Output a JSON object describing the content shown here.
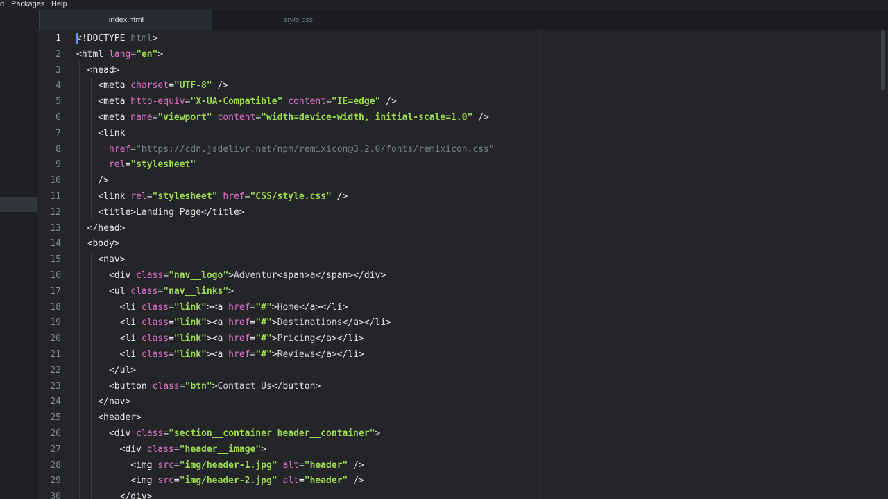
{
  "menu": {
    "items": [
      "d",
      "Packages",
      "Help"
    ]
  },
  "tabs": [
    {
      "label": "index.html",
      "active": true
    },
    {
      "label": "style.css",
      "active": false
    }
  ],
  "editor": {
    "active_line": 1,
    "lines": [
      [
        [
          "t",
          "<!DOCTYPE "
        ],
        [
          "u",
          "html"
        ],
        [
          "t",
          ">"
        ]
      ],
      [
        [
          "t",
          "<html "
        ],
        [
          "a",
          "lang"
        ],
        [
          "t",
          "="
        ],
        [
          "s",
          "\"en\""
        ],
        [
          "t",
          ">"
        ]
      ],
      [
        [
          "t",
          "  <head>"
        ]
      ],
      [
        [
          "t",
          "    <meta "
        ],
        [
          "a",
          "charset"
        ],
        [
          "t",
          "="
        ],
        [
          "s",
          "\"UTF-8\""
        ],
        [
          "t",
          " />"
        ]
      ],
      [
        [
          "t",
          "    <meta "
        ],
        [
          "a",
          "http-equiv"
        ],
        [
          "t",
          "="
        ],
        [
          "s",
          "\"X-UA-Compatible\""
        ],
        [
          "t",
          " "
        ],
        [
          "a",
          "content"
        ],
        [
          "t",
          "="
        ],
        [
          "s",
          "\"IE=edge\""
        ],
        [
          "t",
          " />"
        ]
      ],
      [
        [
          "t",
          "    <meta "
        ],
        [
          "a",
          "name"
        ],
        [
          "t",
          "="
        ],
        [
          "s",
          "\"viewport\""
        ],
        [
          "t",
          " "
        ],
        [
          "a",
          "content"
        ],
        [
          "t",
          "="
        ],
        [
          "s",
          "\"width=device-width, initial-scale=1.0\""
        ],
        [
          "t",
          " />"
        ]
      ],
      [
        [
          "t",
          "    <link"
        ]
      ],
      [
        [
          "t",
          "      "
        ],
        [
          "a",
          "href"
        ],
        [
          "t",
          "="
        ],
        [
          "u",
          "\"https://cdn.jsdelivr.net/npm/remixicon@3.2.0/fonts/remixicon.css\""
        ]
      ],
      [
        [
          "t",
          "      "
        ],
        [
          "a",
          "rel"
        ],
        [
          "t",
          "="
        ],
        [
          "s",
          "\"stylesheet\""
        ]
      ],
      [
        [
          "t",
          "    />"
        ]
      ],
      [
        [
          "t",
          "    <link "
        ],
        [
          "a",
          "rel"
        ],
        [
          "t",
          "="
        ],
        [
          "s",
          "\"stylesheet\""
        ],
        [
          "t",
          " "
        ],
        [
          "a",
          "href"
        ],
        [
          "t",
          "="
        ],
        [
          "s",
          "\"CSS/style.css\""
        ],
        [
          "t",
          " />"
        ]
      ],
      [
        [
          "t",
          "    <title>"
        ],
        [
          "txt",
          "Landing Page"
        ],
        [
          "t",
          "</title>"
        ]
      ],
      [
        [
          "t",
          "  </head>"
        ]
      ],
      [
        [
          "t",
          "  <body>"
        ]
      ],
      [
        [
          "t",
          "    <nav>"
        ]
      ],
      [
        [
          "t",
          "      <div "
        ],
        [
          "a",
          "class"
        ],
        [
          "t",
          "="
        ],
        [
          "s",
          "\"nav__logo\""
        ],
        [
          "t",
          ">"
        ],
        [
          "txt",
          "Adventur"
        ],
        [
          "t",
          "<span>"
        ],
        [
          "txt",
          "a"
        ],
        [
          "t",
          "</span></div>"
        ]
      ],
      [
        [
          "t",
          "      <ul "
        ],
        [
          "a",
          "class"
        ],
        [
          "t",
          "="
        ],
        [
          "s",
          "\"nav__links\""
        ],
        [
          "t",
          ">"
        ]
      ],
      [
        [
          "t",
          "        <li "
        ],
        [
          "a",
          "class"
        ],
        [
          "t",
          "="
        ],
        [
          "s",
          "\"link\""
        ],
        [
          "t",
          "><a "
        ],
        [
          "a",
          "href"
        ],
        [
          "t",
          "="
        ],
        [
          "s",
          "\"#\""
        ],
        [
          "t",
          ">"
        ],
        [
          "txt",
          "Home"
        ],
        [
          "t",
          "</a></li>"
        ]
      ],
      [
        [
          "t",
          "        <li "
        ],
        [
          "a",
          "class"
        ],
        [
          "t",
          "="
        ],
        [
          "s",
          "\"link\""
        ],
        [
          "t",
          "><a "
        ],
        [
          "a",
          "href"
        ],
        [
          "t",
          "="
        ],
        [
          "s",
          "\"#\""
        ],
        [
          "t",
          ">"
        ],
        [
          "txt",
          "Destinations"
        ],
        [
          "t",
          "</a></li>"
        ]
      ],
      [
        [
          "t",
          "        <li "
        ],
        [
          "a",
          "class"
        ],
        [
          "t",
          "="
        ],
        [
          "s",
          "\"link\""
        ],
        [
          "t",
          "><a "
        ],
        [
          "a",
          "href"
        ],
        [
          "t",
          "="
        ],
        [
          "s",
          "\"#\""
        ],
        [
          "t",
          ">"
        ],
        [
          "txt",
          "Pricing"
        ],
        [
          "t",
          "</a></li>"
        ]
      ],
      [
        [
          "t",
          "        <li "
        ],
        [
          "a",
          "class"
        ],
        [
          "t",
          "="
        ],
        [
          "s",
          "\"link\""
        ],
        [
          "t",
          "><a "
        ],
        [
          "a",
          "href"
        ],
        [
          "t",
          "="
        ],
        [
          "s",
          "\"#\""
        ],
        [
          "t",
          ">"
        ],
        [
          "txt",
          "Reviews"
        ],
        [
          "t",
          "</a></li>"
        ]
      ],
      [
        [
          "t",
          "      </ul>"
        ]
      ],
      [
        [
          "t",
          "      <button "
        ],
        [
          "a",
          "class"
        ],
        [
          "t",
          "="
        ],
        [
          "s",
          "\"btn\""
        ],
        [
          "t",
          ">"
        ],
        [
          "txt",
          "Contact Us"
        ],
        [
          "t",
          "</button>"
        ]
      ],
      [
        [
          "t",
          "    </nav>"
        ]
      ],
      [
        [
          "t",
          "    <header>"
        ]
      ],
      [
        [
          "t",
          "      <div "
        ],
        [
          "a",
          "class"
        ],
        [
          "t",
          "="
        ],
        [
          "s",
          "\"section__container header__container\""
        ],
        [
          "t",
          ">"
        ]
      ],
      [
        [
          "t",
          "        <div "
        ],
        [
          "a",
          "class"
        ],
        [
          "t",
          "="
        ],
        [
          "s",
          "\"header__image\""
        ],
        [
          "t",
          ">"
        ]
      ],
      [
        [
          "t",
          "          <img "
        ],
        [
          "a",
          "src"
        ],
        [
          "t",
          "="
        ],
        [
          "s",
          "\"img/header-1.jpg\""
        ],
        [
          "t",
          " "
        ],
        [
          "a",
          "alt"
        ],
        [
          "t",
          "="
        ],
        [
          "s",
          "\"header\""
        ],
        [
          "t",
          " />"
        ]
      ],
      [
        [
          "t",
          "          <img "
        ],
        [
          "a",
          "src"
        ],
        [
          "t",
          "="
        ],
        [
          "s",
          "\"img/header-2.jpg\""
        ],
        [
          "t",
          " "
        ],
        [
          "a",
          "alt"
        ],
        [
          "t",
          "="
        ],
        [
          "s",
          "\"header\""
        ],
        [
          "t",
          " />"
        ]
      ],
      [
        [
          "t",
          "        </div>"
        ]
      ]
    ]
  }
}
